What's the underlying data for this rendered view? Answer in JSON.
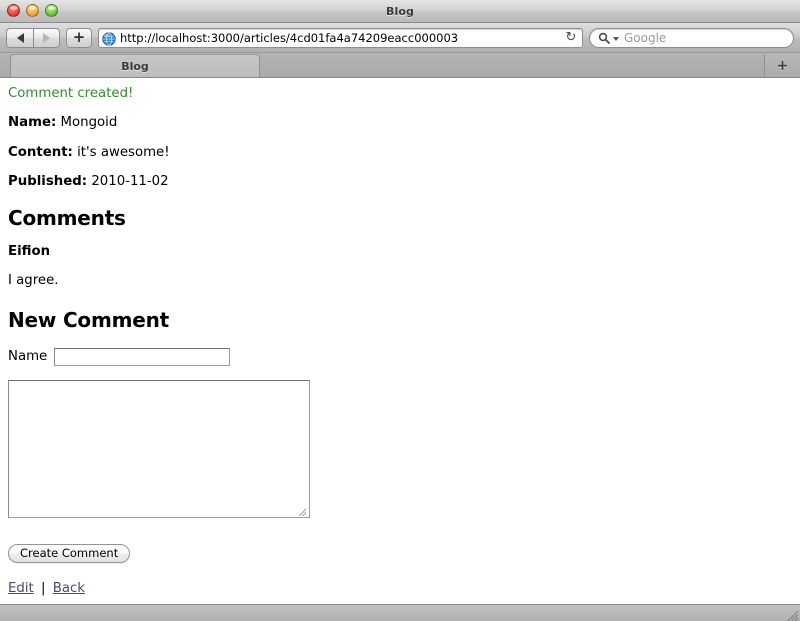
{
  "window": {
    "title": "Blog",
    "traffic_lights": [
      "close-button",
      "minimize-button",
      "zoom-button"
    ]
  },
  "toolbar": {
    "back_label": "Back",
    "forward_label": "Forward",
    "add_label": "+",
    "url": "http://localhost:3000/articles/4cd01fa4a74209eacc000003",
    "reload_glyph": "↻",
    "search_placeholder": "Google"
  },
  "tabs": {
    "items": [
      {
        "label": "Blog",
        "active": true
      }
    ],
    "new_tab_label": "+"
  },
  "page": {
    "notice": "Comment created!",
    "fields": [
      {
        "label": "Name:",
        "value": "Mongoid"
      },
      {
        "label": "Content:",
        "value": "it's awesome!"
      },
      {
        "label": "Published:",
        "value": "2010-11-02"
      }
    ],
    "comments_heading": "Comments",
    "comments": [
      {
        "author": "Eifion",
        "body": "I agree."
      }
    ],
    "new_comment_heading": "New Comment",
    "form": {
      "name_label": "Name",
      "name_value": "",
      "name_placeholder": "",
      "content_value": "",
      "content_placeholder": "",
      "submit_label": "Create Comment"
    },
    "footer_links": [
      {
        "label": "Edit"
      },
      {
        "label": "Back"
      }
    ],
    "link_separator": "|"
  }
}
